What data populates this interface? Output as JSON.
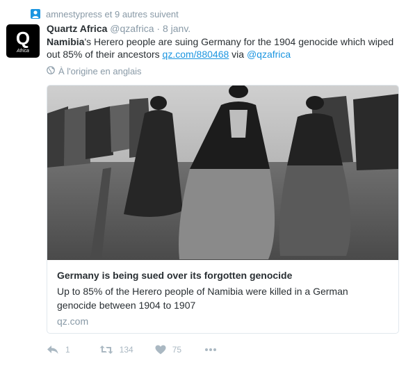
{
  "context": {
    "text": "amnestypress et 9 autres suivent",
    "icon": "person-icon"
  },
  "tweet": {
    "avatar_letter": "Q",
    "avatar_sub": "Africa",
    "name": "Quartz Africa",
    "handle": "@qzafrica",
    "separator": "·",
    "date": "8 janv.",
    "text_bold": "Namibia",
    "text_main": "'s Herero people are suing Germany for the 1904 genocide which wiped out 85% of their ancestors ",
    "link": "qz.com/880468",
    "via": " via ",
    "mention": "@qzafrica",
    "translate": "À l'origine en anglais"
  },
  "card": {
    "title": "Germany is being sued over its forgotten genocide",
    "description": "Up to 85% of the Herero people of Namibia were killed in a German genocide between 1904 to 1907",
    "domain": "qz.com"
  },
  "actions": {
    "reply_count": "1",
    "retweet_count": "134",
    "like_count": "75"
  },
  "colors": {
    "link": "#1b95e0",
    "muted": "#8899a6",
    "icon": "#aab8c2"
  }
}
